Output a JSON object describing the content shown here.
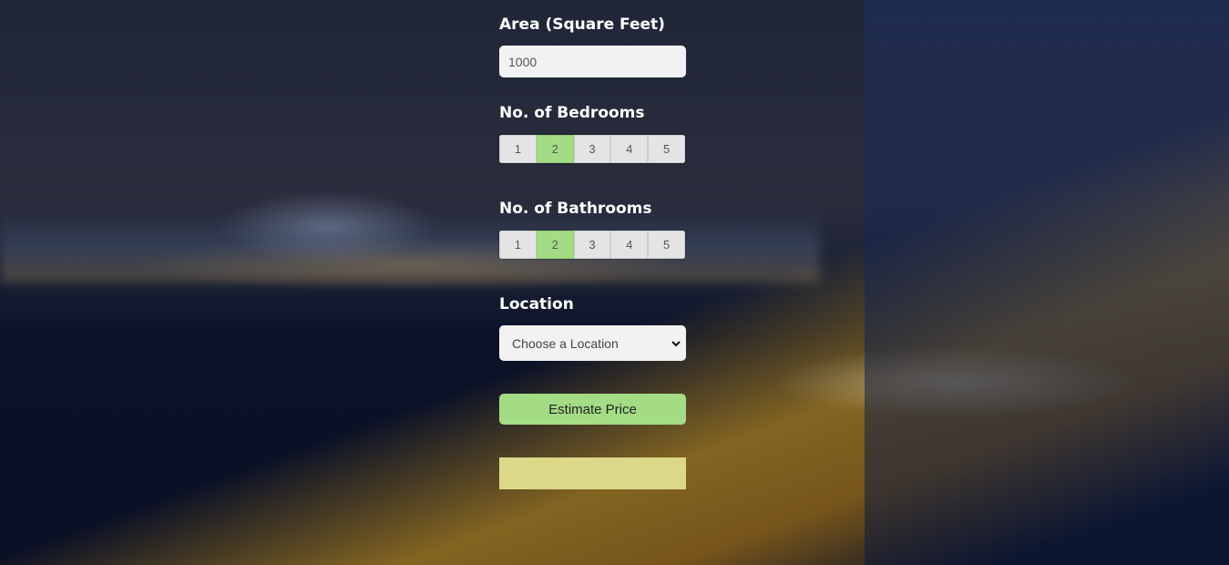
{
  "area": {
    "label": "Area (Square Feet)",
    "value": "1000"
  },
  "bedrooms": {
    "label": "No. of Bedrooms",
    "options": [
      "1",
      "2",
      "3",
      "4",
      "5"
    ],
    "selected": "2"
  },
  "bathrooms": {
    "label": "No. of Bathrooms",
    "options": [
      "1",
      "2",
      "3",
      "4",
      "5"
    ],
    "selected": "2"
  },
  "location": {
    "label": "Location",
    "selected": "Choose a Location"
  },
  "estimate_button": "Estimate Price",
  "result": "",
  "colors": {
    "accent": "#a3dc84",
    "result_bg": "#dcd88a"
  }
}
